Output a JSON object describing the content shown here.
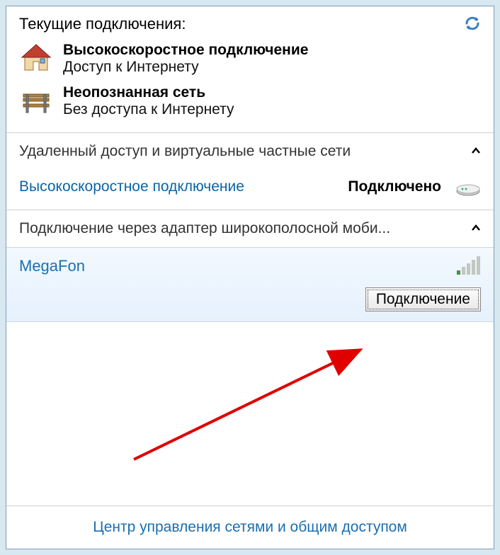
{
  "header": {
    "title": "Текущие подключения:"
  },
  "current_connections": [
    {
      "icon": "house",
      "name": "Высокоскоростное подключение",
      "status": "Доступ к Интернету"
    },
    {
      "icon": "bench",
      "name": "Неопознанная сеть",
      "status": "Без доступа к Интернету"
    }
  ],
  "sections": {
    "vpn": {
      "title": "Удаленный доступ и виртуальные частные сети",
      "item": {
        "name": "Высокоскоростное подключение",
        "status": "Подключено"
      }
    },
    "broadband": {
      "title": "Подключение через адаптер широкополосной моби...",
      "item": {
        "name": "MegaFon",
        "connect_label": "Подключение"
      }
    }
  },
  "footer": {
    "link": "Центр управления сетями и общим доступом"
  }
}
